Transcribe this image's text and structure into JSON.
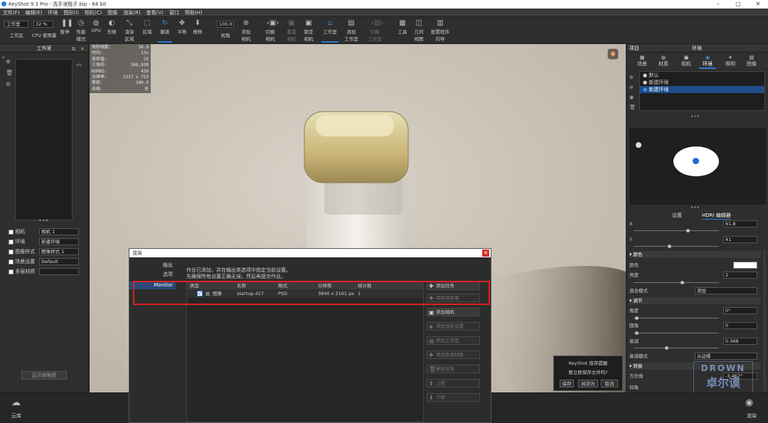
{
  "window": {
    "title": "KeyShot 9.3 Pro  - 洗手液瓶子.bip  - 64 bit"
  },
  "menu": [
    "文件(F)",
    "编辑(E)",
    "环境",
    "图形(I)",
    "相机(C)",
    "图像",
    "渲染(R)",
    "查看(V)",
    "窗口",
    "帮助(H)"
  ],
  "toolbar": {
    "workspace_value": "工作室",
    "workspace_label": "工作区",
    "cpu_value": "32 %",
    "cpu_label": "CPU 使用量",
    "pause": "暂停",
    "perf_mode": "性能\n模式",
    "gpu": "GPU",
    "denoise": "去噪",
    "render_region": "渲染\n区域",
    "region": "区域",
    "flip": "翻滚",
    "pan": "平移",
    "push": "推移",
    "fov_value": "100.0",
    "fov_label": "视角",
    "add_camera": "添加\n相机",
    "switch_camera": "切换\n相机",
    "reset_camera": "重置\n相机",
    "lock_camera": "锁定\n相机",
    "studio": "工作室",
    "add_studio": "添加\n工作室",
    "switch_studio": "切换\n工作室",
    "tools": "工具",
    "geometry_view": "几何\n视图",
    "config_wizard": "配置程序\n向导"
  },
  "left_panel": {
    "title": "工作室",
    "rows": [
      {
        "label": "相机",
        "value": "相机 1"
      },
      {
        "label": "环境",
        "value": "新建环境"
      },
      {
        "label": "图像样式",
        "value": "图像样式 1"
      },
      {
        "label": "场景设置",
        "value": "Default"
      },
      {
        "label": "多层材质",
        "value": ""
      }
    ],
    "button": "显示缩略图"
  },
  "stats": [
    [
      "每秒帧数:",
      "38.0"
    ],
    [
      "时间:",
      "13s"
    ],
    [
      "采样值:",
      "25"
    ],
    [
      "三角形:",
      "368,930"
    ],
    [
      "NURBS:",
      "420"
    ],
    [
      "分辨率:",
      "1337 x 753"
    ],
    [
      "焦距:",
      "100.0"
    ],
    [
      "去噪:",
      "关"
    ]
  ],
  "right_panel": {
    "project": "项目",
    "env": "环境",
    "tabs": [
      "场景",
      "材质",
      "相机",
      "环境",
      "照明",
      "图像"
    ],
    "env_list": [
      "默认",
      "新建环境",
      "新建环境"
    ],
    "subtabs": [
      "设置",
      "HDRI 编辑器"
    ],
    "props": [
      {
        "label": "X",
        "value": "61.8"
      },
      {
        "label": "Y",
        "value": "41"
      }
    ],
    "color_section": "颜色",
    "color_label": "颜色",
    "brightness_label": "亮度",
    "brightness_value": "2",
    "blend_label": "混合模式",
    "blend_value": "添加",
    "adjust_section": "调节",
    "angle_label": "角度",
    "angle_value": "0°",
    "corner_label": "圆角",
    "corner_value": "0",
    "falloff_label": "衰减",
    "falloff_value": "0.368",
    "falloff_mode_label": "衰减模式",
    "falloff_mode_value": "从边缘",
    "transform_section": "转换",
    "azimuth_label": "方位角",
    "azimuth_value": "-3.467°",
    "elevation_label": "仰角"
  },
  "bottom": {
    "cloud": "云库",
    "right_btn": "渲染"
  },
  "dialog": {
    "title": "渲染",
    "nav": [
      "输出",
      "选项",
      "Monitor"
    ],
    "msg1": "作业已添加，并在输出类选项中指定当前设置。",
    "msg2": "先确保所有设置正确无误，然后再提交作业。",
    "cols": [
      "类型",
      "名称",
      "格式",
      "分辨率",
      "帧计数"
    ],
    "row": {
      "type": "图像",
      "name": "startup.427",
      "format": "PSD",
      "resolution": "3840 x 2161 px",
      "frames": "1"
    },
    "actions": [
      "添加任务",
      "添加到目录",
      "添加相机",
      "添加场景设置",
      "添加工作室",
      "添加多层材质",
      "删除任务",
      "上移",
      "下移"
    ]
  },
  "save_popup": {
    "title": "KeyShot 保存提醒",
    "msg": "要立即保存文件吗?",
    "save": "保存",
    "saveas": "另存为",
    "cancel": "取消"
  },
  "watermark": {
    "top": "DROWN",
    "bottom": "卓尔谟"
  }
}
